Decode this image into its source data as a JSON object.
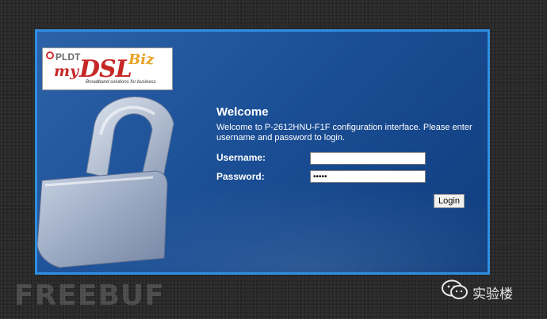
{
  "logo": {
    "brand": "PLDT",
    "product_prefix": "my",
    "product_name": "DSL",
    "product_suffix": "Biz",
    "tagline": "Broadband solutions for business"
  },
  "login": {
    "title": "Welcome",
    "message": "Welcome to P-2612HNU-F1F configuration interface. Please enter username and password to login.",
    "username_label": "Username:",
    "username_value": "",
    "password_label": "Password:",
    "password_value": "admin",
    "login_button": "Login"
  },
  "watermark": {
    "text": "FREEBUF"
  },
  "wechat": {
    "account": "实验楼",
    "icon": "wechat-icon"
  },
  "colors": {
    "panel_border": "#2f8fe0",
    "panel_bg": "#1b4f96",
    "logo_red": "#c62828",
    "logo_orange": "#e6a21f"
  }
}
